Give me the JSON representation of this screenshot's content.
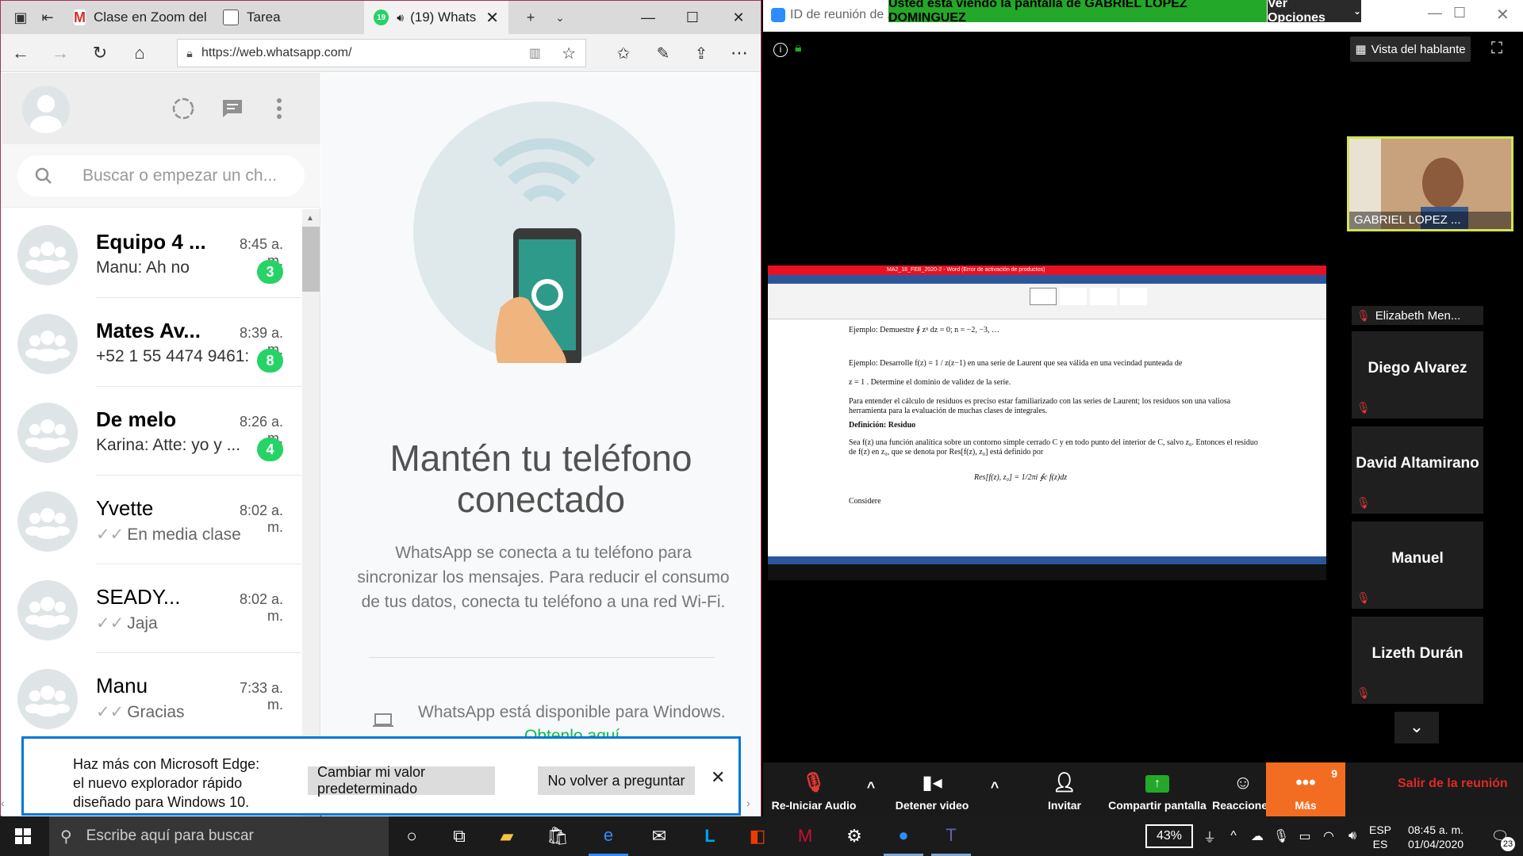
{
  "browser": {
    "tabs": [
      {
        "label": "Clase en Zoom del",
        "favicon": "gmail-icon"
      },
      {
        "label": "Tarea",
        "favicon": "page-icon"
      },
      {
        "label": "(19) Whats",
        "favicon": "whatsapp-icon",
        "badge": "19"
      }
    ],
    "url": "https://web.whatsapp.com/"
  },
  "whatsapp": {
    "search_placeholder": "Buscar o empezar un ch...",
    "chats": [
      {
        "name": "Equipo 4 ...",
        "time": "8:45 a. m.",
        "message": "Manu: Ah no",
        "unread": "3",
        "bold": true
      },
      {
        "name": "Mates Av...",
        "time": "8:39 a. m.",
        "message": "+52 1 55 4474 9461:",
        "unread": "8",
        "bold": true
      },
      {
        "name": "De melo",
        "time": "8:26 a. m.",
        "message": "Karina: Atte: yo y ...",
        "unread": "4",
        "bold": true
      },
      {
        "name": "Yvette",
        "time": "8:02 a. m.",
        "message": "En media clase",
        "unread": "",
        "bold": false
      },
      {
        "name": "SEADY...",
        "time": "8:02 a. m.",
        "message": "Jaja",
        "unread": "",
        "bold": false
      },
      {
        "name": "Manu",
        "time": "7:33 a. m.",
        "message": "Gracias",
        "unread": "",
        "bold": false
      }
    ],
    "intro_title": "Mantén tu teléfono conectado",
    "intro_desc": "WhatsApp se conecta a tu teléfono para sincronizar los mensajes. Para reducir el consumo de tus datos, conecta tu teléfono a una red Wi-Fi.",
    "windows_text": "WhatsApp está disponible para Windows.",
    "windows_link": "Obtenlo aquí."
  },
  "edge_banner": {
    "text": "Haz más con Microsoft Edge: el nuevo explorador rápido diseñado para Windows 10.",
    "btn_default": "Cambiar mi valor predeterminado",
    "btn_never": "No volver a preguntar"
  },
  "zoom": {
    "title": "ID de reunión de Z",
    "share_banner": "Usted está viendo la pantalla de GABRIEL LOPEZ DOMINGUEZ",
    "view_options": "Ver Opciones",
    "speaker_view": "Vista del hablante",
    "self_name": "GABRIEL LOPEZ ...",
    "participants": [
      "Elizabeth Men...",
      "Diego Alvarez",
      "David Altamirano",
      "Manuel",
      "Lizeth Durán"
    ],
    "toolbar": {
      "audio": "Re-Iniciar Audio",
      "video": "Detener video",
      "invite": "Invitar",
      "share": "Compartir pantalla",
      "reactions": "Reacciones",
      "more": "Más",
      "more_badge": "9",
      "leave": "Salir de la reunión"
    },
    "accent": "#24a829",
    "more_color": "#f26d21",
    "leave_color": "#e02828"
  },
  "shared_doc": {
    "title": "MA2_18_FEB_2020-2 - Word (Error de activación de productos)",
    "lines": [
      "Ejemplo: Demuestre ∮ zⁿ dz = 0;   n = −2, −3, …",
      "Ejemplo: Desarrolle f(z) = 1 / z(z−1) en una serie de Laurent que sea válida en una vecindad punteada de",
      "z = 1 . Determine el dominio de validez de la serie.",
      "Para entender el cálculo de residuos es preciso estar familiarizado con las series de Laurent; los residuos son una valiosa herramienta para la evaluación de muchas clases de integrales.",
      "Definición: Residuo",
      "Sea f(z) una función analítica sobre un contorno simple cerrado C y en todo punto del interior de C, salvo z₀. Entonces el residuo de f(z) en z₀, que se denota por Res[f(z), z₀] está definido por",
      "Res[f(z), z₀] = 1/2πi ∮c f(z)dz",
      "Considere"
    ]
  },
  "taskbar": {
    "search": "Escribe aquí para buscar",
    "battery": "43%",
    "lang1": "ESP",
    "lang2": "ES",
    "time": "08:45 a. m.",
    "date": "01/04/2020",
    "notif": "23"
  }
}
